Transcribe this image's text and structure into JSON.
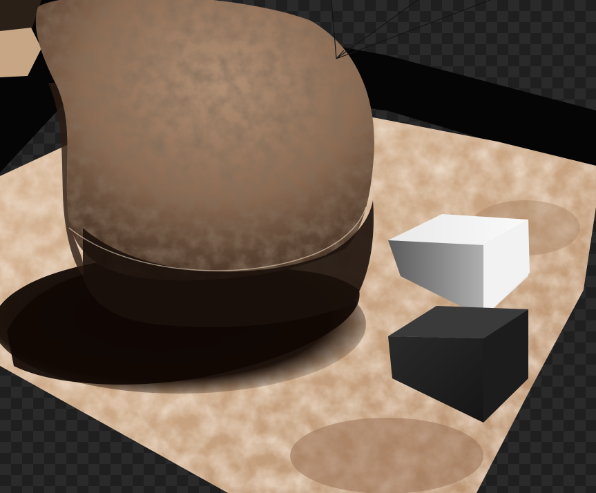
{
  "viewport": {
    "kind": "3d-render-preview",
    "background_pattern": "transparency-checker",
    "colors": {
      "checker_dark": "#1f1f1f",
      "checker_light": "#2a2a2a",
      "void": "#050505",
      "sand_light": "#d9b899",
      "sand_mid": "#b38c6c",
      "sand_dark": "#7a5840",
      "rock_light": "#a6856b",
      "rock_dark": "#3d2b1f",
      "shadow": "#100804",
      "cube_white": "#f2f2f2",
      "cube_white_side": "#9a9a9a",
      "cube_dark": "#3a3a3a",
      "cube_dark_side": "#1c1c1c",
      "wire": "#141414"
    }
  },
  "scene_objects": [
    {
      "name": "rock",
      "material": "rock-texture"
    },
    {
      "name": "sand-ground-plane",
      "material": "sand-texture"
    },
    {
      "name": "white-cube",
      "material": "white-diffuse"
    },
    {
      "name": "dark-cube",
      "material": "dark-diffuse"
    },
    {
      "name": "camera-frustum",
      "material": "wireframe"
    }
  ]
}
